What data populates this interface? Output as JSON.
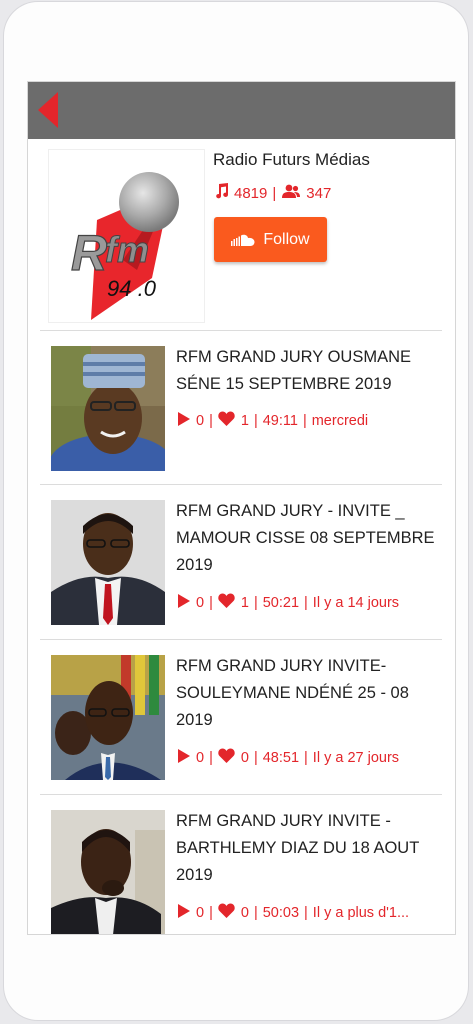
{
  "header": {
    "back_icon": "back-arrow-icon",
    "bar_color": "#6c6c6c",
    "accent": "#e3262b"
  },
  "profile": {
    "name": "Radio Futurs Médias",
    "tracks_count": "4819",
    "followers_count": "347",
    "follow_label": "Follow",
    "logo": {
      "text_main": "Rfm",
      "text_sub": "94.0"
    }
  },
  "tracks": [
    {
      "title": "RFM GRAND JURY OUSMANE SÉNE 15 SEPTEMBRE 2019",
      "plays": "0",
      "likes": "1",
      "duration": "49:11",
      "date": "mercredi"
    },
    {
      "title": "RFM GRAND JURY - INVITE _ MAMOUR CISSE 08 SEPTEMBRE 2019",
      "plays": "0",
      "likes": "1",
      "duration": "50:21",
      "date": "Il y a 14 jours"
    },
    {
      "title": "RFM GRAND JURY INVITE- SOULEYMANE NDÉNÉ 25 - 08 2019",
      "plays": "0",
      "likes": "0",
      "duration": "48:51",
      "date": "Il y a 27 jours"
    },
    {
      "title": "RFM GRAND JURY INVITE - BARTHLEMY DIAZ DU 18 AOUT 2019",
      "plays": "0",
      "likes": "0",
      "duration": "50:03",
      "date": "Il y a plus d'1..."
    }
  ]
}
